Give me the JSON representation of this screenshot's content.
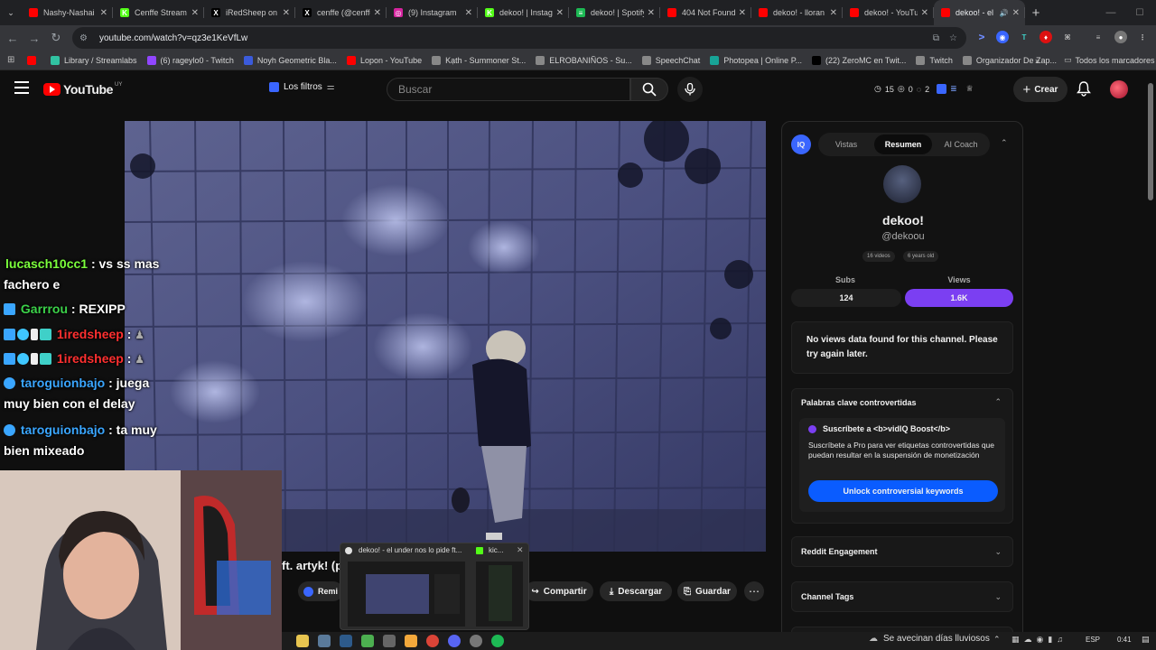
{
  "browser": {
    "tabs": [
      {
        "title": "Nashy-Nashai",
        "fav_color": "#ff0000",
        "fav_char": ""
      },
      {
        "title": "Cenffe Stream",
        "fav_color": "#53fc18",
        "fav_char": "K"
      },
      {
        "title": "iRedSheep on X",
        "fav_color": "#000000",
        "fav_char": "X"
      },
      {
        "title": "cenffe (@cenffe)",
        "fav_color": "#000000",
        "fav_char": "X"
      },
      {
        "title": "(9) Instagram",
        "fav_color": "#d6249f",
        "fav_char": "◎"
      },
      {
        "title": "dekoo! | Instagram",
        "fav_color": "#53fc18",
        "fav_char": "K"
      },
      {
        "title": "dekoo! | Spotify",
        "fav_color": "#1db954",
        "fav_char": "≡"
      },
      {
        "title": "404 Not Found",
        "fav_color": "#ff0000",
        "fav_char": ""
      },
      {
        "title": "dekoo! - lloran",
        "fav_color": "#ff0000",
        "fav_char": ""
      },
      {
        "title": "dekoo! - YouTube",
        "fav_color": "#ff0000",
        "fav_char": ""
      },
      {
        "title": "dekoo! - el",
        "fav_color": "#ff0000",
        "fav_char": ""
      }
    ],
    "url": "youtube.com/watch?v=qz3e1KeVfLw",
    "bookmarks": [
      {
        "label": "",
        "color": "#ff0000"
      },
      {
        "label": "Library / Streamlabs",
        "color": "#31c3a2"
      },
      {
        "label": "(6) rageylo0 - Twitch",
        "color": "#9146ff"
      },
      {
        "label": "Noyh Geometric Bla...",
        "color": "#3b5bdb"
      },
      {
        "label": "Lopon - YouTube",
        "color": "#ff0000"
      },
      {
        "label": "Kạth - Summoner St...",
        "color": "#888888"
      },
      {
        "label": "ELROBANIÑOS - Su...",
        "color": "#888888"
      },
      {
        "label": "SpeechChat",
        "color": "#888888"
      },
      {
        "label": "Photopea | Online P...",
        "color": "#18a497"
      },
      {
        "label": "(22) ZeroMC en Twit...",
        "color": "#000000"
      },
      {
        "label": "Twitch",
        "color": "#888888"
      },
      {
        "label": "Organizador De Zap...",
        "color": "#888888"
      }
    ],
    "all_bookmarks": "Todos los marcadores"
  },
  "youtube": {
    "logo_text": "YouTube",
    "region": "UY",
    "filters_label": "Los filtros",
    "search_placeholder": "Buscar",
    "stats": {
      "a": "15",
      "b": "0",
      "c": "2"
    },
    "create_label": "Crear",
    "video_title_fragment": "ft. artyk! (p",
    "actions": {
      "remix": "Remi",
      "share": "Compartir",
      "download": "Descargar",
      "save": "Guardar"
    }
  },
  "vidiq_panel": {
    "tabs": [
      "Vistas",
      "Resumen",
      "AI Coach"
    ],
    "active_tab": "Resumen",
    "channel_name": "dekoo!",
    "channel_handle": "@dekoou",
    "videos_chip": "16 videos",
    "age_chip": "6 years old",
    "subs_label": "Subs",
    "views_label": "Views",
    "subs_value": "124",
    "views_value": "1.6K",
    "no_data_msg": "No views data found for this channel. Please try again later.",
    "keywords_title": "Palabras clave controvertidas",
    "boost_title": "Suscríbete a <b>vidIQ Boost</b>",
    "boost_desc": "Suscríbete a Pro para ver etiquetas controvertidas que puedan resultar en la suspensión de monetización",
    "unlock_button": "Unlock controversial keywords",
    "reddit_title": "Reddit Engagement",
    "tags_title": "Channel Tags",
    "accent_color": "#7b3ff2",
    "button_color": "#0a5cff"
  },
  "chat": [
    {
      "user": "lucasch10cc1",
      "color": "#7cff3c",
      "text": ": vs ss mas fachero e"
    },
    {
      "user": "Garrrou",
      "color": "#3cd24a",
      "text": ": REXIPP"
    },
    {
      "user": "1iredsheep",
      "color": "#ff3030",
      "text": ":"
    },
    {
      "user": "1iredsheep",
      "color": "#ff3030",
      "text": ":"
    },
    {
      "user": "taroguionbajo",
      "color": "#3aa6ff",
      "text": ": juega muy bien con el delay"
    },
    {
      "user": "taroguionbajo",
      "color": "#3aa6ff",
      "text": ": ta muy bien mixeado"
    }
  ],
  "taskbar_preview": {
    "item1": "dekoo! - el under nos lo pide ft...",
    "item2": "kic..."
  },
  "system_tray": {
    "weather": "Se avecinan días lluviosos",
    "lang": "ESP",
    "time": "0:41"
  }
}
